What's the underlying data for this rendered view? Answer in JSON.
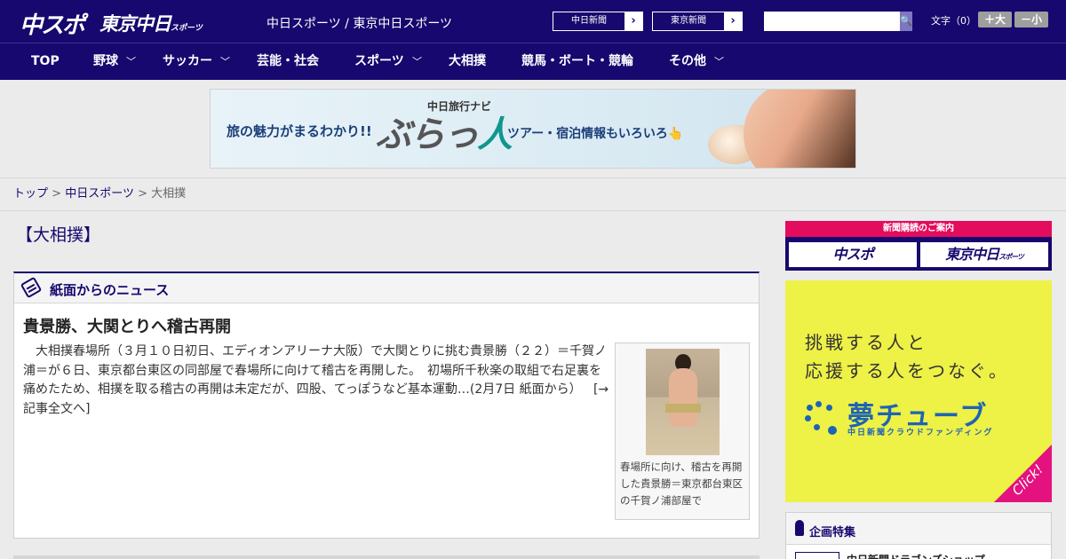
{
  "header": {
    "logo_chuspo": "中スポ",
    "logo_tokyo": "東京中日",
    "logo_tokyo_small": "スポーツ",
    "site_title": "中日スポーツ / 東京中日スポーツ",
    "link_chunichi": "中日新聞",
    "link_tokyo": "東京新聞",
    "search_placeholder": "",
    "search_button": "🔍",
    "font_size_label": "文字（0）",
    "font_up": "＋大",
    "font_down": "－小"
  },
  "nav": {
    "items": [
      "TOP",
      "野球",
      "サッカー",
      "芸能・社会",
      "スポーツ",
      "大相撲",
      "競馬・ボート・競輪",
      "その他"
    ]
  },
  "banner": {
    "left_text": "旅の魅力がまるわかり!!",
    "label": "中日旅行ナビ",
    "logo_a": "ぶらっ",
    "logo_b": "人",
    "right_text": "ツアー・宿泊情報もいろいろ👆"
  },
  "breadcrumb": {
    "home": "トップ",
    "section": "中日スポーツ",
    "current": "大相撲",
    "sep": ">"
  },
  "page_heading": "【大相撲】",
  "news": {
    "box_label": "紙面からのニュース",
    "title": "貴景勝、大関とりへ稽古再開",
    "body": "　大相撲春場所（３月１０日初日、エディオンアリーナ大阪）で大関とりに挑む貴景勝（２２）＝千賀ノ浦＝が６日、東京都台東区の同部屋で春場所に向けて稽古を再開した。　初場所千秋楽の取組で右足裏を痛めたため、相撲を取る稽古の再開は未定だが、四股、てっぽうなど基本運動…(2月7日 紙面から）",
    "more": "[→記事全文へ]",
    "photo_caption": "春場所に向け、稽古を再開した貴景勝＝東京都台東区の千賀ノ浦部屋で"
  },
  "sidebar": {
    "subscribe_bar": "新聞購読のご案内",
    "subscribe_chuspo": "中スポ",
    "subscribe_tokyo": "東京中日",
    "subscribe_tokyo_small": "スポーツ",
    "ad_line1": "挑戦する人と",
    "ad_line2": "応援する人をつなぐ。",
    "ad_brand": "夢チューブ",
    "ad_brand_sub": "中日新聞クラウドファンディング",
    "ad_click": "Click!",
    "feature_label": "企画特集",
    "feature_item": "中日新聞ドラゴンズショップ"
  },
  "colors": {
    "brand_navy": "#16086e",
    "accent_pink": "#e40c5c",
    "ad_yellow": "#eef146"
  }
}
